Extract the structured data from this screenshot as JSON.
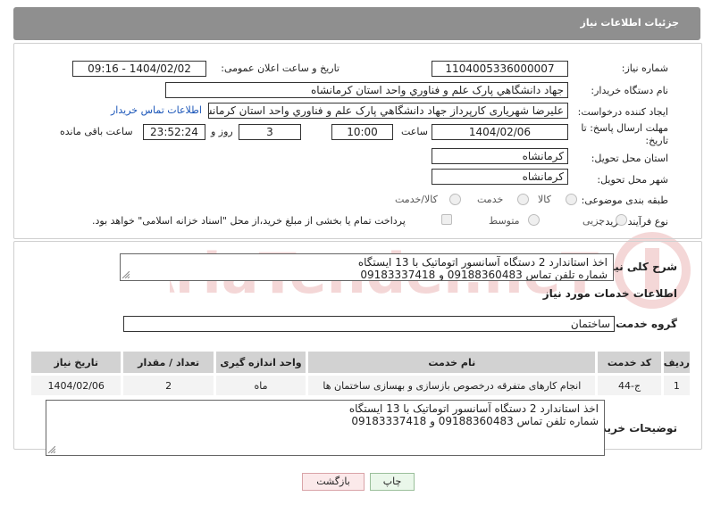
{
  "header": {
    "title": "جزئیات اطلاعات نیاز"
  },
  "watermark": {
    "text": "AriaTender.neT"
  },
  "form": {
    "need_number": {
      "label": "شماره نیاز:",
      "value": "1104005336000007"
    },
    "announce": {
      "label": "تاریخ و ساعت اعلان عمومی:",
      "value": "1404/02/02 - 09:16"
    },
    "buyer_org": {
      "label": "نام دستگاه خریدار:",
      "value": "جهاد دانشگاهي پارک علم و فناوري واحد استان کرمانشاه"
    },
    "creator": {
      "label": "ایجاد کننده درخواست:",
      "value": "علیرضا شهریاری کارپرداز جهاد دانشگاهي پارک علم و فناوري واحد استان کرمانشاه",
      "contact_link": "اطلاعات تماس خریدار"
    },
    "deadline": {
      "label_line1": "مهلت ارسال پاسخ: تا",
      "label_line2": "تاریخ:",
      "date": "1404/02/06",
      "time_label": "ساعت",
      "time": "10:00",
      "days": "3",
      "days_label": "روز و",
      "remaining": "23:52:24",
      "remaining_label": "ساعت باقی مانده"
    },
    "province": {
      "label": "استان محل تحویل:",
      "value": "کرمانشاه"
    },
    "city": {
      "label": "شهر محل تحویل:",
      "value": "کرمانشاه"
    },
    "category": {
      "label": "طبقه بندی موضوعی:",
      "options": [
        "کالا",
        "خدمت",
        "کالا/خدمت"
      ]
    },
    "process": {
      "label": "نوع فرآیند خرید :",
      "options": [
        "جزیی",
        "متوسط"
      ],
      "treasury_note": "پرداخت تمام یا بخشی از مبلغ خرید،از محل \"اسناد خزانه اسلامی\" خواهد بود."
    }
  },
  "description": {
    "label": "شرح کلی نیاز:",
    "line1": "اخذ استاندارد 2 دستگاه آسانسور اتوماتیک با 13 ایستگاه",
    "line2": "شماره تلفن تماس 09188360483 و 09183337418"
  },
  "services": {
    "section_title": "اطلاعات خدمات مورد نیاز",
    "group_label": "گروه خدمت:",
    "group_value": "ساختمان",
    "columns": [
      "ردیف",
      "کد خدمت",
      "نام خدمت",
      "واحد اندازه گیری",
      "تعداد / مقدار",
      "تاریخ نیاز"
    ],
    "rows": [
      [
        "1",
        "ج-44",
        "انجام کارهای متفرقه درخصوص بازسازی و بهسازی ساختمان ها",
        "ماه",
        "2",
        "1404/02/06"
      ]
    ]
  },
  "buyer_notes": {
    "label": "توضیحات خریدار:",
    "line1": "اخذ استاندارد 2 دستگاه آسانسور اتوماتیک با 13 ایستگاه",
    "line2": "شماره تلفن تماس 09188360483 و 09183337418"
  },
  "buttons": {
    "print": "چاپ",
    "back": "بازگشت"
  },
  "colors": {
    "header_bg": "#8f8f8f",
    "link": "#1a55b8",
    "table_header": "#d2d2d2",
    "print_bg": "#eaf7ea",
    "back_bg": "#fbe9ea"
  }
}
